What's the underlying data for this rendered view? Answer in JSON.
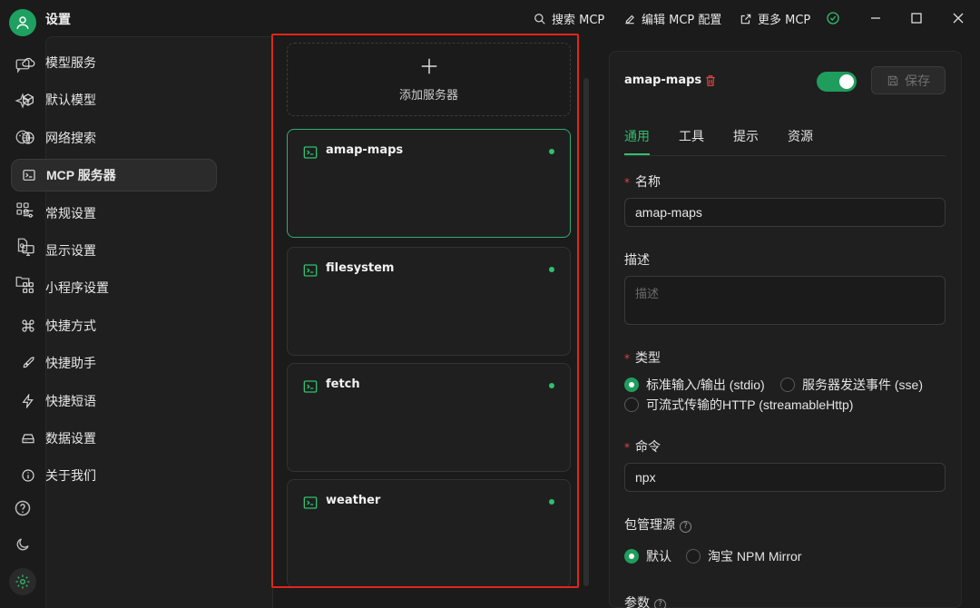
{
  "app": {
    "title": "设置"
  },
  "top_actions": {
    "search": "搜索 MCP",
    "edit": "编辑 MCP 配置",
    "more": "更多 MCP"
  },
  "sidebar": {
    "items": [
      {
        "label": "模型服务",
        "icon": "cloud-icon"
      },
      {
        "label": "默认模型",
        "icon": "cube-icon"
      },
      {
        "label": "网络搜索",
        "icon": "globe-icon"
      },
      {
        "label": "MCP 服务器",
        "icon": "terminal-icon",
        "active": true
      },
      {
        "label": "常规设置",
        "icon": "sliders-icon"
      },
      {
        "label": "显示设置",
        "icon": "monitor-icon"
      },
      {
        "label": "小程序设置",
        "icon": "grid-icon"
      },
      {
        "label": "快捷方式",
        "icon": "command-icon"
      },
      {
        "label": "快捷助手",
        "icon": "rocket-icon"
      },
      {
        "label": "快捷短语",
        "icon": "zap-icon"
      },
      {
        "label": "数据设置",
        "icon": "drive-icon"
      },
      {
        "label": "关于我们",
        "icon": "info-icon"
      }
    ]
  },
  "server_list": {
    "add_label": "添加服务器",
    "servers": [
      {
        "name": "amap-maps",
        "active": true
      },
      {
        "name": "filesystem"
      },
      {
        "name": "fetch"
      },
      {
        "name": "weather"
      }
    ]
  },
  "detail": {
    "server_name": "amap-maps",
    "enabled": true,
    "save_label": "保存",
    "tabs": [
      "通用",
      "工具",
      "提示",
      "资源"
    ],
    "active_tab": "通用",
    "fields": {
      "name_label": "名称",
      "name_value": "amap-maps",
      "desc_label": "描述",
      "desc_placeholder": "描述",
      "type_label": "类型",
      "type_options": [
        "标准输入/输出 (stdio)",
        "服务器发送事件 (sse)",
        "可流式传输的HTTP (streamableHttp)"
      ],
      "command_label": "命令",
      "command_value": "npx",
      "registry_label": "包管理源",
      "registry_options": [
        "默认",
        "淘宝 NPM Mirror"
      ],
      "args_label": "参数"
    }
  },
  "colors": {
    "accent": "#1f9d5c",
    "highlight_frame": "#e0261b",
    "background": "#1b1b1b"
  }
}
